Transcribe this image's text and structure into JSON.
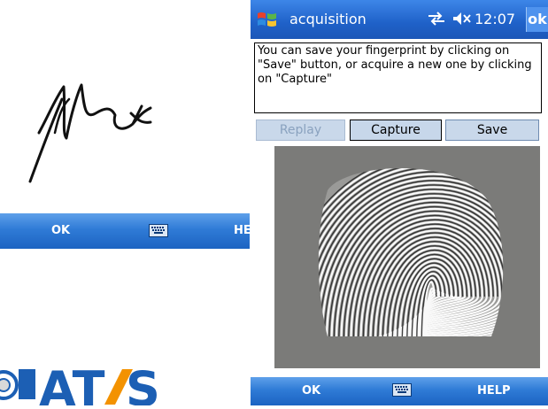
{
  "left_device": {
    "softkeys": {
      "left": "OK",
      "right": "HELP"
    },
    "icons": {
      "keyboard": "keyboard-icon"
    }
  },
  "right_device": {
    "title_bar": {
      "title": "acquisition",
      "time": "12:07",
      "ok_label": "ok",
      "icons": {
        "start": "windows-flag-icon",
        "connectivity": "connectivity-icon",
        "volume": "volume-muted-icon"
      }
    },
    "message": "You can save your fingerprint by clicking on \"Save\" button, or acquire a new one by clicking on \"Capture\"",
    "buttons": {
      "replay": "Replay",
      "capture": "Capture",
      "save": "Save"
    },
    "softkeys": {
      "left": "OK",
      "right": "HELP"
    }
  },
  "logo": {
    "text": "ATOS"
  },
  "colors": {
    "title_bar": "#1f61c8",
    "softkey_bar": "#2f7bd6",
    "button": "#c9d8ea",
    "fingerprint_bg": "#7b7b79",
    "logo_blue": "#1c5fb4",
    "logo_orange": "#f39200"
  }
}
